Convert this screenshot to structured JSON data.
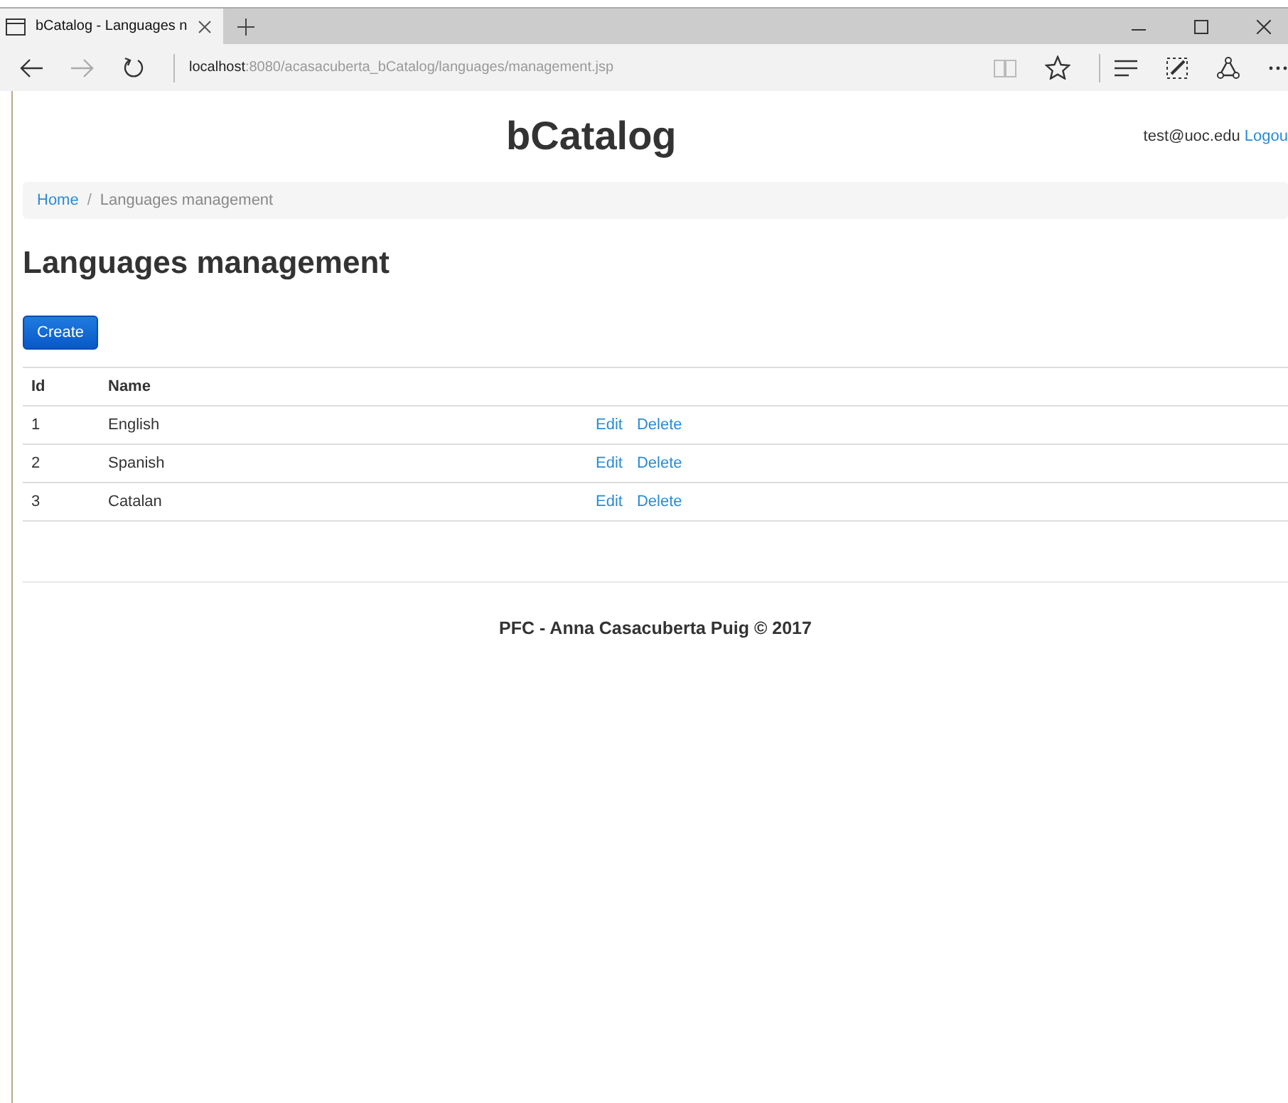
{
  "browser": {
    "tab": {
      "title": "bCatalog - Languages n"
    },
    "address": {
      "host": "localhost",
      "path": ":8080/acasacuberta_bCatalog/languages/management.jsp"
    }
  },
  "header": {
    "brand": "bCatalog",
    "user": "test@uoc.edu",
    "logout": "Logou"
  },
  "breadcrumb": {
    "separator": "/",
    "items": [
      {
        "label": "Home",
        "kind": "link"
      },
      {
        "label": "Languages management",
        "kind": "current"
      }
    ]
  },
  "title": "Languages management",
  "create_button": "Create",
  "table": {
    "columns": [
      "Id",
      "Name"
    ],
    "rows": [
      {
        "id": "1",
        "name": "English",
        "actions": [
          "Edit",
          "Delete"
        ]
      },
      {
        "id": "2",
        "name": "Spanish",
        "actions": [
          "Edit",
          "Delete"
        ]
      },
      {
        "id": "3",
        "name": "Catalan",
        "actions": [
          "Edit",
          "Delete"
        ]
      }
    ]
  },
  "footer": "PFC - Anna Casacuberta Puig © 2017"
}
